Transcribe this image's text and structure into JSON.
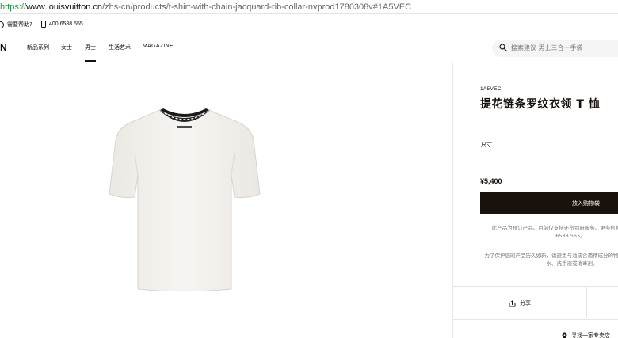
{
  "url": {
    "scheme": "https://",
    "host": "www.louisvuitton.cn",
    "path": "/zhs-cn/products/t-shirt-with-chain-jacquard-rib-collar-nvprod1780308v#1A5VEC"
  },
  "utility": {
    "help": "需要帮助?",
    "phone": "400 6588 555"
  },
  "nav": {
    "logo": "N",
    "items": [
      "新品系列",
      "女士",
      "男士",
      "生活艺术",
      "MAGAZINE"
    ],
    "active_index": 2,
    "search_placeholder": "搜索建议 男士三合一手袋"
  },
  "product": {
    "sku": "1A5VEC",
    "title": "提花链条罗纹衣领 T 恤",
    "size_label": "尺寸",
    "price": "¥5,400",
    "add_to_bag": "放入购物袋",
    "note1_line1": "此产品为预订产品。目前仅支持还货到府服务。更多信息",
    "note1_line2": "6588 555。",
    "note2_line1": "为了保护您的产品历久如新，请避免与油或含酒精成分的物",
    "note2_line2": "水、洗手液或消毒剂。",
    "share": "分享",
    "store": "寻找一家专卖店"
  },
  "colors": {
    "brand_dark": "#19110b",
    "url_green": "#1a9c3a"
  }
}
